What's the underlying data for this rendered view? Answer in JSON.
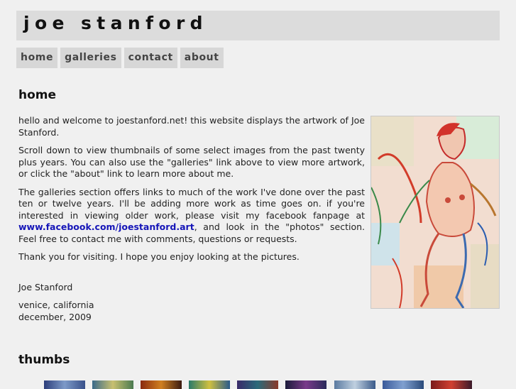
{
  "site": {
    "title": "joe stanford"
  },
  "nav": [
    {
      "label": "home"
    },
    {
      "label": "galleries"
    },
    {
      "label": "contact"
    },
    {
      "label": "about"
    }
  ],
  "main": {
    "heading": "home",
    "paragraphs": {
      "p1": "hello and welcome to joestanford.net! this website displays the artwork of Joe Stanford.",
      "p2": "Scroll down to view thumbnails of some select images from the past twenty plus years. You can also use the \"galleries\" link above to view more artwork, or click the \"about\" link to learn more about me.",
      "p3_before": "The galleries section offers links to much of the work I've done over the past ten or twelve years. I'll be adding more work as time goes on. if you're interested in viewing older work, please visit my facebook fanpage at ",
      "p3_link": "www.facebook.com/joestanford.art",
      "p3_after": ", and look in the \"photos\" section. Feel free to contact me with comments, questions or requests.",
      "p4": "Thank you for visiting. I hope you enjoy looking at the pictures."
    },
    "signature": "Joe Stanford",
    "location": "venice, california",
    "date": "december, 2009"
  },
  "thumbs": {
    "heading": "thumbs"
  },
  "colors": {
    "background": "#f0f0f0",
    "bar": "#dcdcdc",
    "link": "#1515b8"
  }
}
